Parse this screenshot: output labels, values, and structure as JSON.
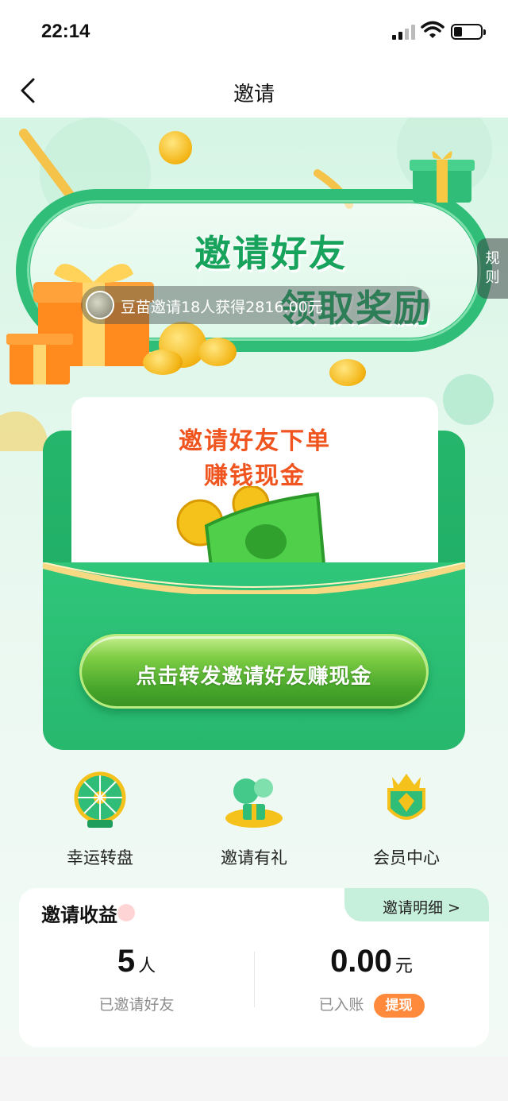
{
  "status_bar": {
    "time": "22:14"
  },
  "nav": {
    "title": "邀请",
    "back_icon": "chevron-left-icon"
  },
  "banner": {
    "title_line1": "邀请好友",
    "title_line2": "领取奖励",
    "ticker_text": "豆苗邀请18人获得2816.00元",
    "rule_label": "规则"
  },
  "invite_card": {
    "headline_line1": "邀请好友下单",
    "headline_line2": "赚钱现金",
    "cta_label": "点击转发邀请好友赚现金"
  },
  "entries": [
    {
      "label": "幸运转盘",
      "icon": "lucky-wheel-icon"
    },
    {
      "label": "邀请有礼",
      "icon": "gift-balloon-icon"
    },
    {
      "label": "会员中心",
      "icon": "crown-badge-icon"
    }
  ],
  "income": {
    "title": "邀请收益",
    "detail_link": "邀请明细 >",
    "invited_count": "5",
    "invited_unit": "人",
    "invited_label": "已邀请好友",
    "amount": "0.00",
    "amount_unit": "元",
    "amount_label": "已入账",
    "withdraw_label": "提现"
  },
  "colors": {
    "brand_green": "#27b86e",
    "accent_orange": "#f0541f",
    "withdraw_orange": "#ff8a3c"
  }
}
